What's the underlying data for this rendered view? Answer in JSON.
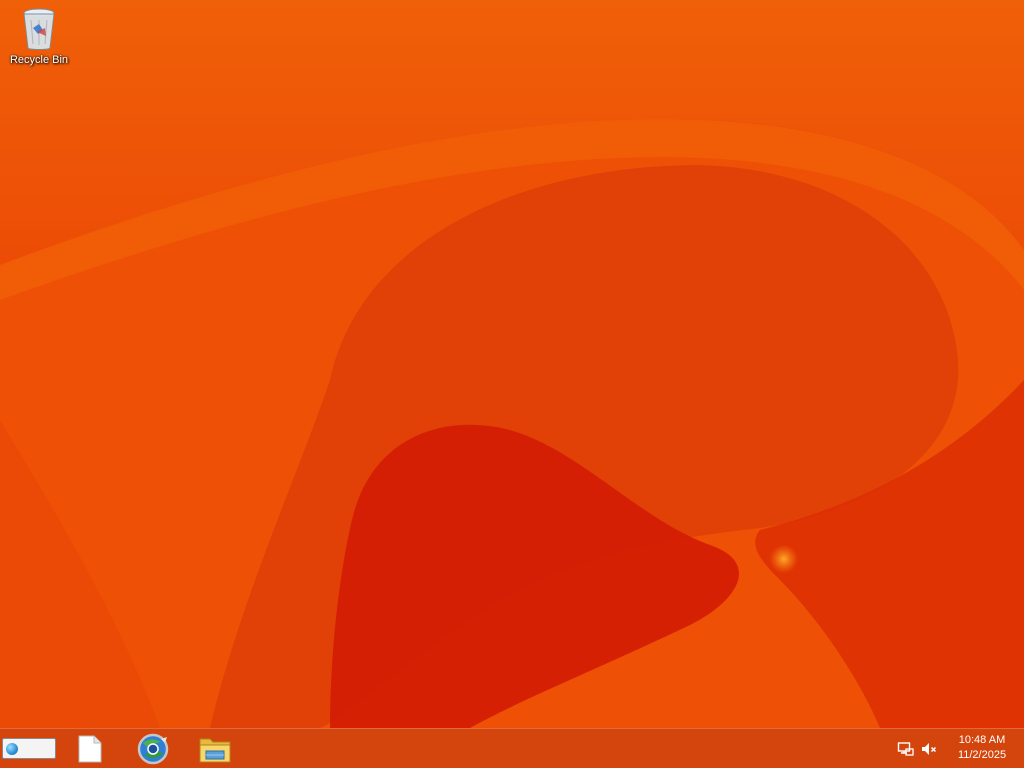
{
  "desktop": {
    "icons": [
      {
        "label": "Recycle Bin",
        "icon": "recycle-bin-icon"
      }
    ]
  },
  "taskbar": {
    "start_button": {
      "label": "",
      "icon": "globe-icon"
    },
    "pinned": [
      {
        "name": "document",
        "icon": "document-icon"
      },
      {
        "name": "browser",
        "icon": "browser-icon"
      },
      {
        "name": "file-explorer",
        "icon": "folder-icon"
      }
    ],
    "tray": {
      "icons": [
        "network-icon",
        "volume-muted-icon"
      ],
      "time": "10:48 AM",
      "date": "11/2/2025"
    }
  },
  "colors": {
    "wallpaper_base": "#ef5505",
    "wallpaper_dark": "#d81a04",
    "wallpaper_light": "#f87a0c"
  }
}
